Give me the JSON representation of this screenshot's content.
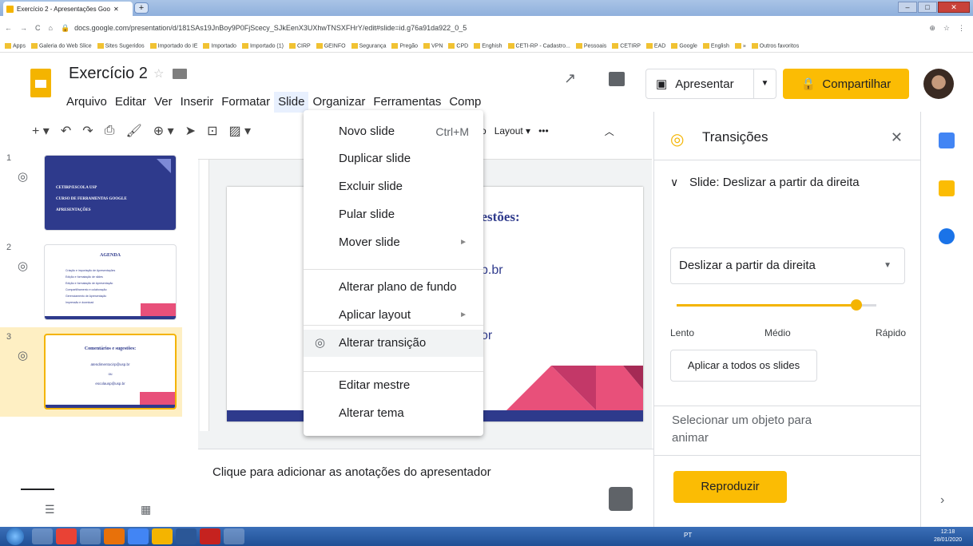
{
  "browser": {
    "tab_title": "Exercício 2 - Apresentações Goo",
    "url": "docs.google.com/presentation/d/181SAs19JnBoy9P0FjScecy_SJkEenX3UXhwTNSXFHrY/edit#slide=id.g76a91da922_0_5",
    "bookmarks": [
      "Apps",
      "Galeria do Web Slice",
      "Sites Sugeridos",
      "Importado do IE",
      "Importado",
      "Importado (1)",
      "CIRP",
      "GEINFO",
      "Segurança",
      "Pregão",
      "VPN",
      "CPD",
      "Enghish",
      "CETI-RP - Cadastro...",
      "Pessoais",
      "CETIRP",
      "EAD",
      "Google",
      "English",
      "»",
      "Outros favoritos"
    ]
  },
  "app": {
    "doc_title": "Exercício 2",
    "menus": [
      "Arquivo",
      "Editar",
      "Ver",
      "Inserir",
      "Formatar",
      "Slide",
      "Organizar",
      "Ferramentas",
      "Comp"
    ],
    "present_label": "Apresentar",
    "share_label": "Compartilhar",
    "layout_label": "Layout",
    "toolbar_cut_text": "o"
  },
  "slide_menu": {
    "items": [
      {
        "label": "Novo slide",
        "shortcut": "Ctrl+M"
      },
      {
        "label": "Duplicar slide"
      },
      {
        "label": "Excluir slide"
      },
      {
        "label": "Pular slide"
      },
      {
        "label": "Mover slide",
        "submenu": true
      },
      {
        "label": "Alterar plano de fundo"
      },
      {
        "label": "Aplicar layout",
        "submenu": true
      },
      {
        "label": "Alterar transição",
        "highlighted": true
      },
      {
        "label": "Editar mestre"
      },
      {
        "label": "Alterar tema"
      }
    ]
  },
  "slides": [
    {
      "number": "1",
      "lines": [
        "CETIRP/ESCOLA USP",
        "CURSO DE FERRAMENTAS GOOGLE",
        "APRESENTAÇÕES"
      ]
    },
    {
      "number": "2",
      "title": "AGENDA",
      "bullets": [
        "Criação e importação de Apresentações",
        "Edição e formatação de slides",
        "Edição e formatação de Apresentação",
        "Compartilhamento e colaboração",
        "Gerenciamento de Apresentação",
        "Impressão e download"
      ]
    },
    {
      "number": "3",
      "title": "Comentários e sugestões:",
      "lines": [
        "atendimentocirp@usp.br",
        "ou",
        "escolausp@usp.br"
      ]
    }
  ],
  "canvas": {
    "visible_fragments": [
      "gestões:",
      "p.br",
      "or"
    ]
  },
  "notes": {
    "placeholder": "Clique para adicionar as anotações do apresentador"
  },
  "panel": {
    "title": "Transições",
    "transition_heading": "Slide: Deslizar a partir da direita",
    "dropdown_value": "Deslizar a partir da direita",
    "speed_level": 0.9,
    "speed_labels": [
      "Lento",
      "Médio",
      "Rápido"
    ],
    "apply_all": "Aplicar a todos os slides",
    "select_object": "Selecionar um objeto para animar",
    "play": "Reproduzir"
  },
  "taskbar": {
    "lang": "PT",
    "time": "12:18",
    "date": "28/01/2020"
  },
  "colors": {
    "accent": "#fbbc04",
    "slide_blue": "#2e3a8c",
    "slide_pink": "#e8507a",
    "menu_highlight": "#e8f0fe"
  }
}
